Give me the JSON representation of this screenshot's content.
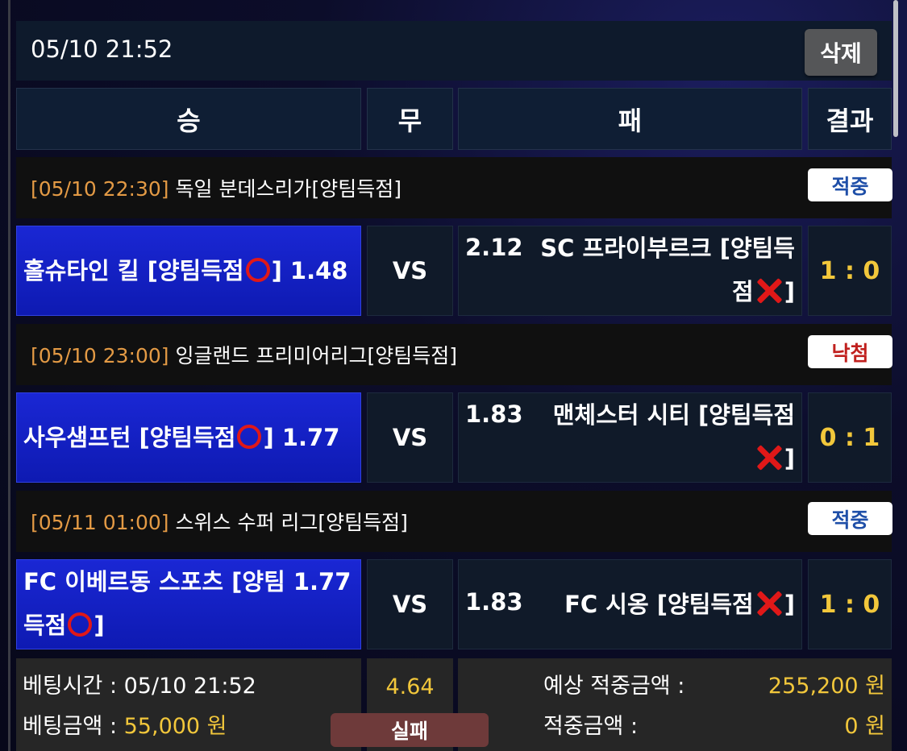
{
  "header": {
    "datetime": "05/10 21:52",
    "delete_label": "삭제"
  },
  "columns": {
    "win": "승",
    "draw": "무",
    "lose": "패",
    "result": "결과"
  },
  "games": [
    {
      "time": "[05/10 22:30]",
      "league": "독일 분데스리가[양팀득점]",
      "status": "적중",
      "status_color": "#1f4fa8",
      "home_line1": "홀슈타인 킬 [양팀득점",
      "home_line1_end": "] 1.48",
      "home_line2": "",
      "vs": "VS",
      "away_odds": "2.12",
      "away_line1": "SC 프라이부르크 [양팀득",
      "away_line2": "점",
      "away_line2_end": "]",
      "score": "1 : 0"
    },
    {
      "time": "[05/10 23:00]",
      "league": "잉글랜드 프리미어리그[양팀득점]",
      "status": "낙첨",
      "status_color": "#c0201e",
      "home_line1": "사우샘프턴 [양팀득점",
      "home_line1_end": "]  1.77",
      "home_line2": "",
      "vs": "VS",
      "away_odds": "1.83",
      "away_line1": "맨체스터 시티 [양팀득점",
      "away_line2": "",
      "away_line2_end": "]",
      "score": "0 : 1"
    },
    {
      "time": "[05/11 01:00]",
      "league": "스위스 수퍼 리그[양팀득점]",
      "status": "적중",
      "status_color": "#1f4fa8",
      "home_line1": "FC 이베르동 스포츠 [양팀  1.77",
      "home_line2": "득점",
      "home_line2_end": "]",
      "vs": "VS",
      "away_odds": "1.83",
      "away_line1": "FC 시옹 [양팀득점",
      "away_line1_end": "]",
      "score": "1 : 0"
    }
  ],
  "footer": {
    "bet_time_label": "베팅시간 : ",
    "bet_time_value": "05/10 21:52",
    "bet_amount_label": "베팅금액 : ",
    "bet_amount_value": "55,000 원",
    "total_odds": "4.64",
    "outcome": "실패",
    "expected_label": "예상 적중금액 :",
    "expected_value": "255,200 원",
    "won_label": "적중금액 :",
    "won_value": "0 원"
  },
  "colors": {
    "home_blue": "#1a27d4",
    "score_yellow": "#f2c73b",
    "league_time_orange": "#e39a45",
    "fail_badge": "#6e3a3a"
  }
}
